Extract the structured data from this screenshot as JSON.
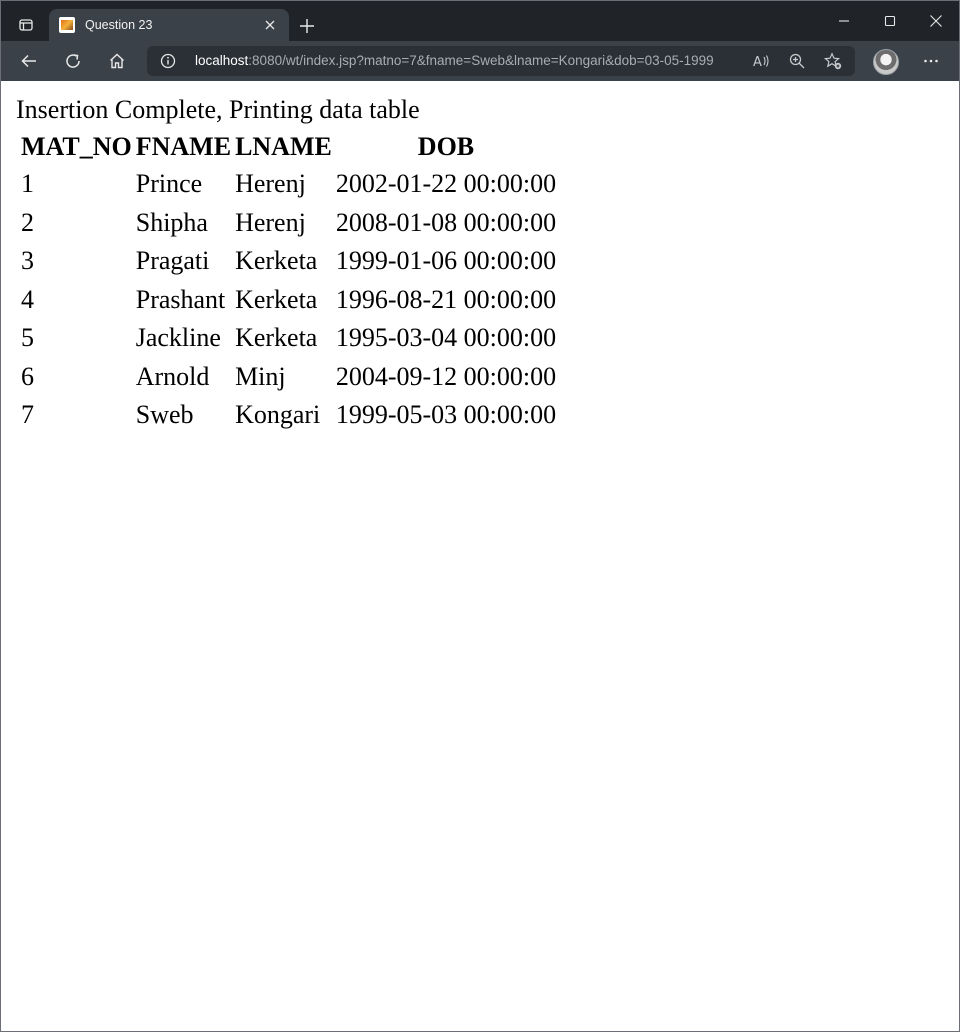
{
  "browser": {
    "tab": {
      "title": "Question 23"
    },
    "address": {
      "host": "localhost",
      "path": ":8080/wt/index.jsp?matno=7&fname=Sweb&lname=Kongari&dob=03-05-1999"
    },
    "colors": {
      "titlebar": "#202428",
      "toolbar": "#3b4148",
      "omnibox": "#2b3036"
    }
  },
  "page": {
    "message": "Insertion Complete, Printing data table",
    "table": {
      "headers": [
        "MAT_NO",
        "FNAME",
        "LNAME",
        "DOB"
      ],
      "rows": [
        [
          "1",
          "Prince",
          "Herenj",
          "2002-01-22 00:00:00"
        ],
        [
          "2",
          "Shipha",
          "Herenj",
          "2008-01-08 00:00:00"
        ],
        [
          "3",
          "Pragati",
          "Kerketa",
          "1999-01-06 00:00:00"
        ],
        [
          "4",
          "Prashant",
          "Kerketa",
          "1996-08-21 00:00:00"
        ],
        [
          "5",
          "Jackline",
          "Kerketa",
          "1995-03-04 00:00:00"
        ],
        [
          "6",
          "Arnold",
          "Minj",
          "2004-09-12 00:00:00"
        ],
        [
          "7",
          "Sweb",
          "Kongari",
          "1999-05-03 00:00:00"
        ]
      ]
    }
  }
}
